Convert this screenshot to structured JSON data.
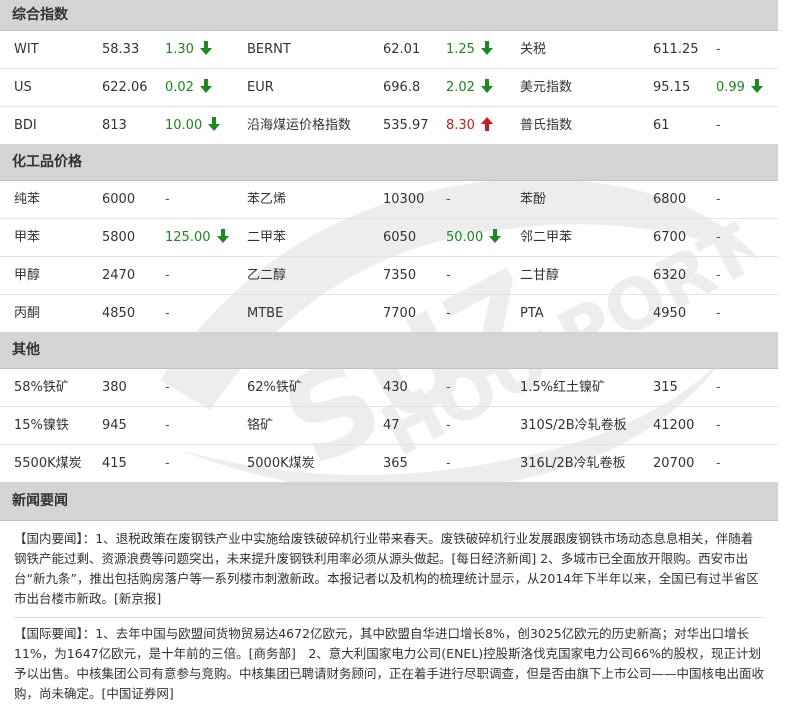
{
  "colors": {
    "section_bg": "#d4d4d4",
    "down": "#1a8a1a",
    "up": "#d7161b",
    "watermark": "#efefef"
  },
  "sections": {
    "composite": {
      "title": "综合指数",
      "rows": [
        [
          {
            "name": "WIT",
            "value": "58.33",
            "change": "1.30",
            "dir": "down"
          },
          {
            "name": "BERNT",
            "value": "62.01",
            "change": "1.25",
            "dir": "down"
          },
          {
            "name": "关税",
            "value": "611.25",
            "change": "-",
            "dir": "flat"
          }
        ],
        [
          {
            "name": "US",
            "value": "622.06",
            "change": "0.02",
            "dir": "down"
          },
          {
            "name": "EUR",
            "value": "696.8",
            "change": "2.02",
            "dir": "down"
          },
          {
            "name": "美元指数",
            "value": "95.15",
            "change": "0.99",
            "dir": "down"
          }
        ],
        [
          {
            "name": "BDI",
            "value": "813",
            "change": "10.00",
            "dir": "down"
          },
          {
            "name": "沿海煤运价格指数",
            "value": "535.97",
            "change": "8.30",
            "dir": "up"
          },
          {
            "name": "普氏指数",
            "value": "61",
            "change": "-",
            "dir": "flat"
          }
        ]
      ]
    },
    "chemical": {
      "title": "化工品价格",
      "rows": [
        [
          {
            "name": "纯苯",
            "value": "6000",
            "change": "-",
            "dir": "flat"
          },
          {
            "name": "苯乙烯",
            "value": "10300",
            "change": "-",
            "dir": "flat"
          },
          {
            "name": "苯酚",
            "value": "6800",
            "change": "-",
            "dir": "flat"
          }
        ],
        [
          {
            "name": "甲苯",
            "value": "5800",
            "change": "125.00",
            "dir": "down"
          },
          {
            "name": "二甲苯",
            "value": "6050",
            "change": "50.00",
            "dir": "down"
          },
          {
            "name": "邻二甲苯",
            "value": "6700",
            "change": "-",
            "dir": "flat"
          }
        ],
        [
          {
            "name": "甲醇",
            "value": "2470",
            "change": "-",
            "dir": "flat"
          },
          {
            "name": "乙二醇",
            "value": "7350",
            "change": "-",
            "dir": "flat"
          },
          {
            "name": "二甘醇",
            "value": "6320",
            "change": "-",
            "dir": "flat"
          }
        ],
        [
          {
            "name": "丙酮",
            "value": "4850",
            "change": "-",
            "dir": "flat"
          },
          {
            "name": "MTBE",
            "value": "7700",
            "change": "-",
            "dir": "flat"
          },
          {
            "name": "PTA",
            "value": "4950",
            "change": "-",
            "dir": "flat"
          }
        ]
      ]
    },
    "other": {
      "title": "其他",
      "rows": [
        [
          {
            "name": "58%铁矿",
            "value": "380",
            "change": "-",
            "dir": "flat"
          },
          {
            "name": "62%铁矿",
            "value": "430",
            "change": "-",
            "dir": "flat"
          },
          {
            "name": "1.5%红土镍矿",
            "value": "315",
            "change": "-",
            "dir": "flat"
          }
        ],
        [
          {
            "name": "15%镍铁",
            "value": "945",
            "change": "-",
            "dir": "flat"
          },
          {
            "name": "铬矿",
            "value": "47",
            "change": "-",
            "dir": "flat"
          },
          {
            "name": "310S/2B冷轧卷板",
            "value": "41200",
            "change": "-",
            "dir": "flat"
          }
        ],
        [
          {
            "name": "5500K煤炭",
            "value": "415",
            "change": "-",
            "dir": "flat"
          },
          {
            "name": "5000K煤炭",
            "value": "365",
            "change": "-",
            "dir": "flat"
          },
          {
            "name": "316L/2B冷轧卷板",
            "value": "20700",
            "change": "-",
            "dir": "flat"
          }
        ]
      ]
    }
  },
  "news": {
    "title": "新闻要闻",
    "domestic": "【国内要闻】：1、退税政策在废钢铁产业中实施给废铁破碎机行业带来春天。废铁破碎机行业发展跟废钢铁市场动态息息相关，伴随着钢铁产能过剩、资源浪费等问题突出，未来提升废钢铁利用率必须从源头做起。[每日经济新闻] 2、多城市已全面放开限购。西安市出台“新九条”，推出包括购房落户等一系列楼市刺激新政。本报记者以及机构的梳理统计显示，从2014年下半年以来，全国已有过半省区市出台楼市新政。[新京报]",
    "international": "【国际要闻】：1、去年中国与欧盟间货物贸易达4672亿欧元，其中欧盟自华进口增长8%，创3025亿欧元的历史新高；对华出口增长11%，为1647亿欧元，是十年前的三倍。[商务部]　2、意大利国家电力公司(ENEL)控股斯洛伐克国家电力公司66%的股权，现正计划予以出售。中核集团公司有意参与竞购。中核集团已聘请财务顾问，正在着手进行尽职调查，但是否由旗下上市公司——中国核电出面收购，尚未确定。[中国证券网]"
  }
}
